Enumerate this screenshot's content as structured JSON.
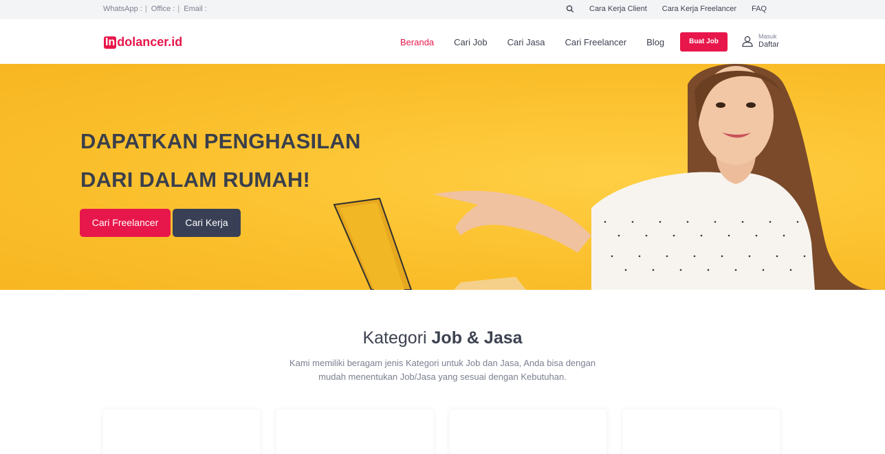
{
  "topbar": {
    "whatsapp": "WhatsApp :",
    "office": "Office :",
    "email": "Email :",
    "separator": "|",
    "links": [
      "Cara Kerja Client",
      "Cara Kerja Freelancer",
      "FAQ"
    ]
  },
  "header": {
    "logo_badge": "In",
    "logo_text": "dolancer.id",
    "nav": [
      "Beranda",
      "Cari Job",
      "Cari Jasa",
      "Cari Freelancer",
      "Blog"
    ],
    "active_nav": "Beranda",
    "buat_job": "Buat Job",
    "masuk": "Masuk",
    "daftar": "Daftar"
  },
  "hero": {
    "title_line1": "DAPATKAN PENGHASILAN",
    "title_line2": "DARI DALAM RUMAH!",
    "btn_freelancer": "Cari Freelancer",
    "btn_kerja": "Cari Kerja"
  },
  "categories": {
    "title_light": "Kategori",
    "title_bold": "Job & Jasa",
    "description": "Kami memiliki beragam jenis Kategori untuk Job dan Jasa, Anda bisa dengan mudah menentukan Job/Jasa yang sesuai dengan Kebutuhan."
  },
  "colors": {
    "accent": "#e8174b",
    "dark_button": "#394056",
    "hero_bg": "#fcc32f"
  }
}
